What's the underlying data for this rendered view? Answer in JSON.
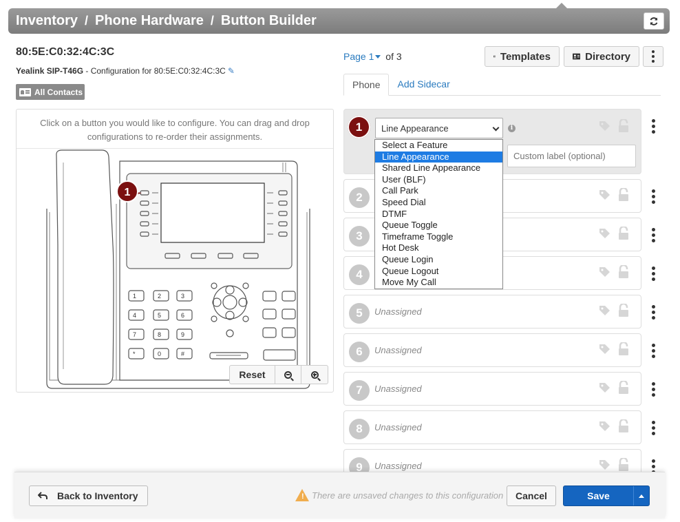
{
  "breadcrumb": [
    "Inventory",
    "Phone Hardware",
    "Button Builder"
  ],
  "device": {
    "mac": "80:5E:C0:32:4C:3C",
    "model": "Yealink SIP-T46G",
    "config_text": " - Configuration for 80:5E:C0:32:4C:3C"
  },
  "contacts_button": "All Contacts",
  "instructions": "Click on a button you would like to configure. You can drag and drop configurations to re-order their assignments.",
  "phone_callout": "1",
  "keypad_keys": [
    "1",
    "2",
    "3",
    "4",
    "5",
    "6",
    "7",
    "8",
    "9",
    "*",
    "0",
    "#"
  ],
  "zoom": {
    "reset": "Reset"
  },
  "pager": {
    "page_label": "Page",
    "page": "1",
    "of_label": "of 3"
  },
  "toolbar": {
    "templates": "Templates",
    "directory": "Directory"
  },
  "tabs": [
    {
      "label": "Phone",
      "active": true
    },
    {
      "label": "Add Sidecar",
      "active": false
    }
  ],
  "active_slot": {
    "number": "1",
    "selected_feature": "Line Appearance",
    "label_placeholder": "Custom label (optional)"
  },
  "feature_options": [
    "Select a Feature",
    "Line Appearance",
    "Shared Line Appearance",
    "User (BLF)",
    "Call Park",
    "Speed Dial",
    "DTMF",
    "Queue Toggle",
    "Timeframe Toggle",
    "Hot Desk",
    "Queue Login",
    "Queue Logout",
    "Move My Call"
  ],
  "selected_option_index": 1,
  "slots": [
    {
      "number": "2",
      "status": ""
    },
    {
      "number": "3",
      "status": ""
    },
    {
      "number": "4",
      "status": ""
    },
    {
      "number": "5",
      "status": "Unassigned"
    },
    {
      "number": "6",
      "status": "Unassigned"
    },
    {
      "number": "7",
      "status": "Unassigned"
    },
    {
      "number": "8",
      "status": "Unassigned"
    },
    {
      "number": "9",
      "status": "Unassigned"
    }
  ],
  "footer": {
    "back": "Back to Inventory",
    "unsaved": "There are unsaved changes to this configuration",
    "cancel": "Cancel",
    "save": "Save"
  },
  "colors": {
    "accent": "#1565c0",
    "badge_active": "#7b1010",
    "link": "#2a7bbf",
    "header": "#8a8a8a"
  }
}
